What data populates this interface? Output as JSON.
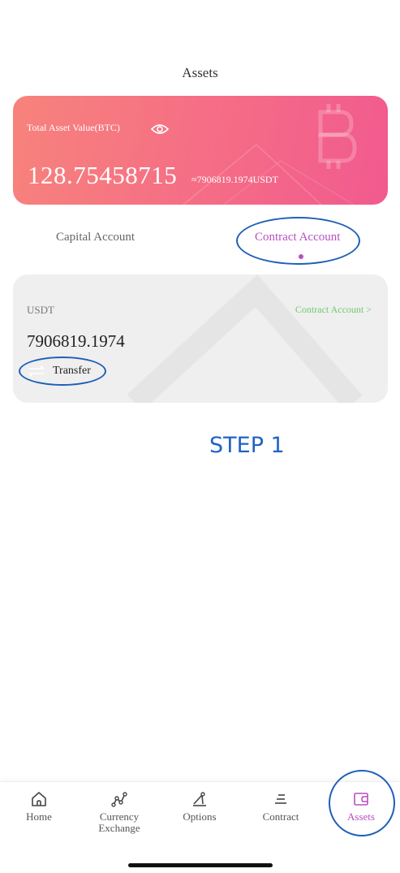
{
  "header": {
    "title": "Assets"
  },
  "asset_card": {
    "label": "Total Asset Value(BTC)",
    "btc_value": "128.75458715",
    "usdt_approx": "≈7906819.1974USDT",
    "visibility_icon": "eye-icon",
    "watermark_icon": "bitcoin-icon",
    "gradient": [
      "#f7837c",
      "#f15a8f"
    ]
  },
  "tabs": [
    {
      "label": "Capital Account",
      "active": false
    },
    {
      "label": "Contract Account",
      "active": true
    }
  ],
  "account": {
    "currency": "USDT",
    "link_label": "Contract Account >",
    "amount": "7906819.1974",
    "transfer_label": "Transfer",
    "transfer_icon": "transfer-arrows-icon"
  },
  "annotation": {
    "step_text": "STEP 1",
    "color": "#1f63c4"
  },
  "nav": [
    {
      "label": "Home",
      "icon": "home-icon",
      "active": false
    },
    {
      "label": "Currency Exchange",
      "icon": "exchange-icon",
      "active": false
    },
    {
      "label": "Options",
      "icon": "options-icon",
      "active": false
    },
    {
      "label": "Contract",
      "icon": "contract-icon",
      "active": false
    },
    {
      "label": "Assets",
      "icon": "wallet-icon",
      "active": true
    }
  ],
  "colors": {
    "accent": "#b84fc0",
    "link_green": "#6ec96f",
    "highlight_ring": "#1f5fb8"
  }
}
